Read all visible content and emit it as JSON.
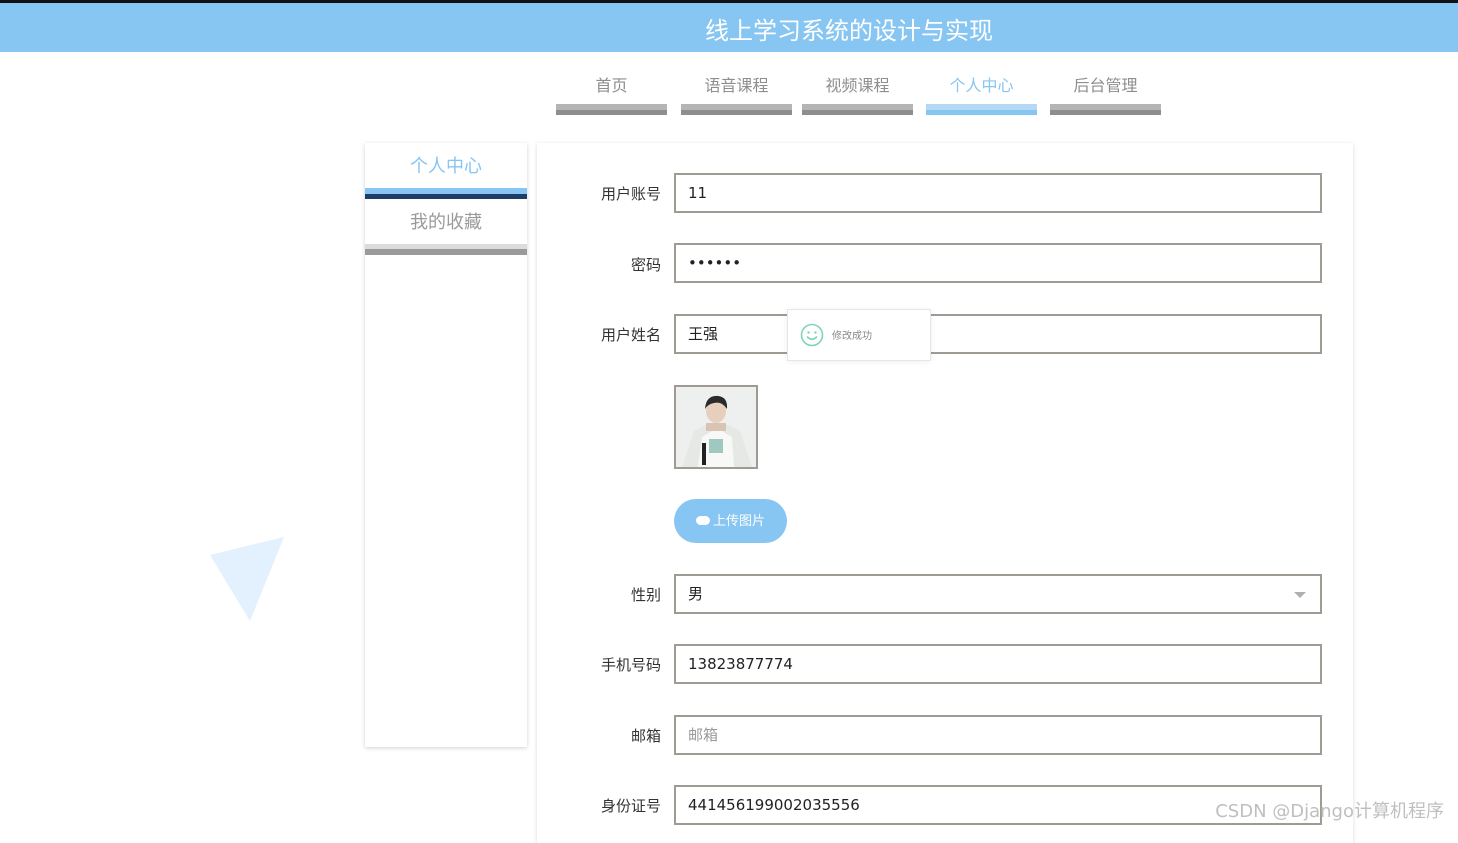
{
  "header": {
    "title": "线上学习系统的设计与实现"
  },
  "nav": {
    "items": [
      {
        "label": "首页"
      },
      {
        "label": "语音课程"
      },
      {
        "label": "视频课程"
      },
      {
        "label": "个人中心"
      },
      {
        "label": "后台管理"
      }
    ],
    "active_label": "个人中心"
  },
  "sidebar": {
    "items": [
      {
        "label": "个人中心"
      },
      {
        "label": "我的收藏"
      }
    ],
    "active_label": "个人中心"
  },
  "form": {
    "account": {
      "label": "用户账号",
      "value": "11"
    },
    "password": {
      "label": "密码",
      "value": "••••••"
    },
    "name": {
      "label": "用户姓名",
      "value": "王强"
    },
    "upload_button": "上传图片",
    "gender": {
      "label": "性别",
      "value": "男"
    },
    "phone": {
      "label": "手机号码",
      "value": "13823877774"
    },
    "email": {
      "label": "邮箱",
      "placeholder": "邮箱"
    },
    "id_number": {
      "label": "身份证号",
      "value": "441456199002035556"
    }
  },
  "toast": {
    "text": "修改成功"
  },
  "watermark": "CSDN @Django计算机程序",
  "colors": {
    "accent": "#87c5f2",
    "dark_accent": "#1d3f66",
    "border": "#a09a95"
  }
}
